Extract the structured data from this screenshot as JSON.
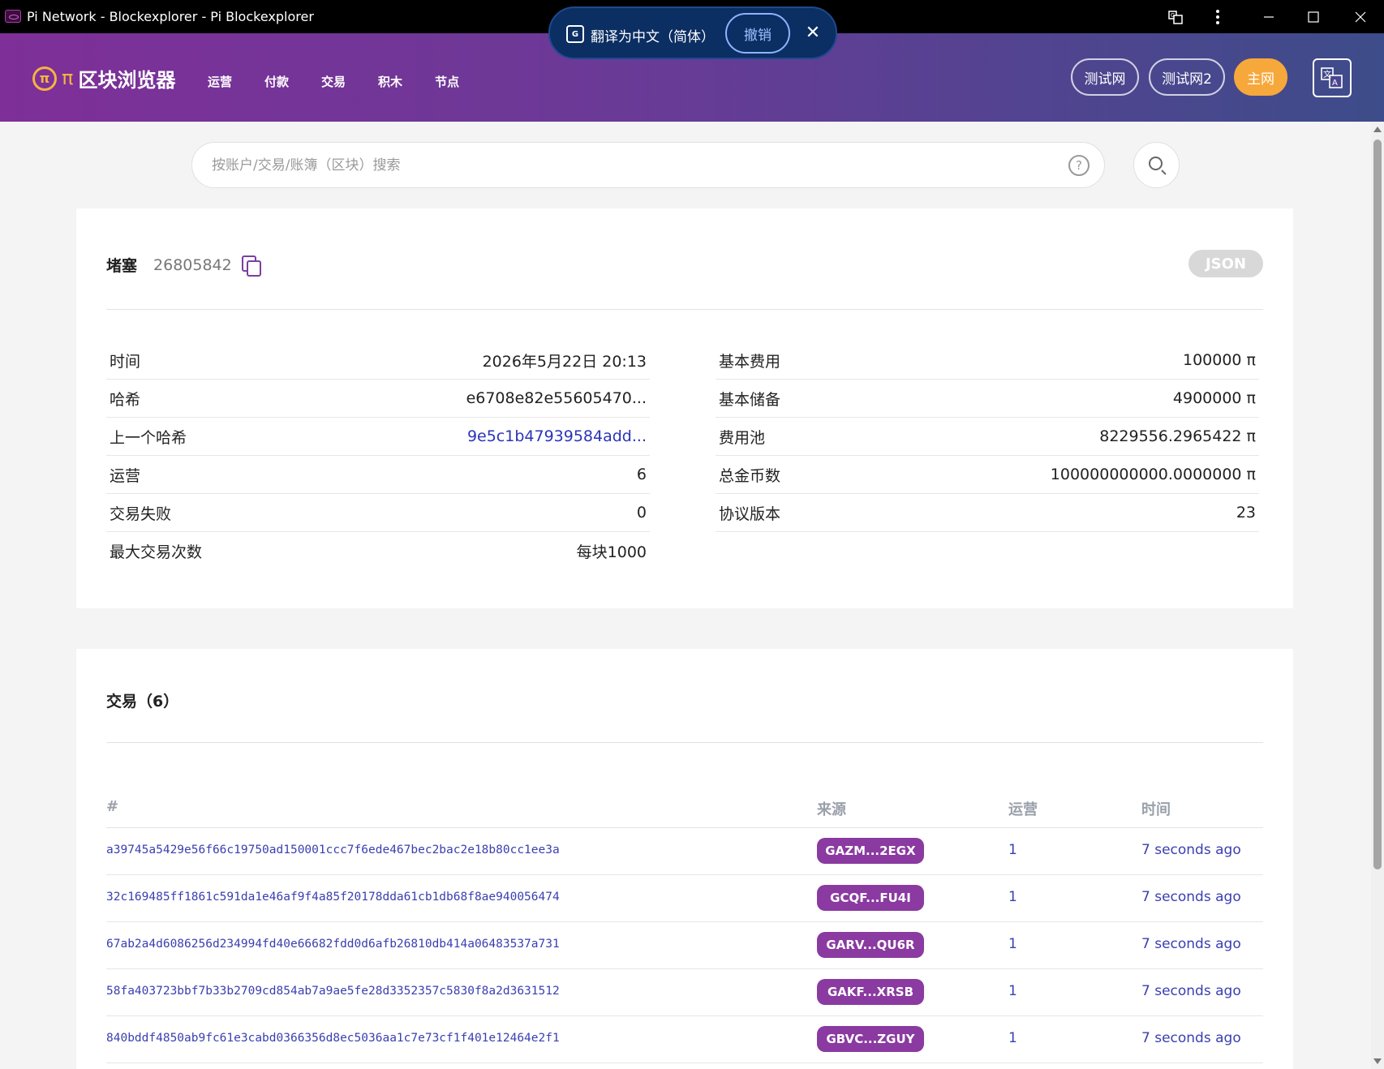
{
  "window": {
    "title": "Pi Network - Blockexplorer - Pi Blockexplorer"
  },
  "translate_bar": {
    "text": "翻译为中文（简体）",
    "undo_label": "撤销",
    "close_label": "✕"
  },
  "header": {
    "logo_text": "区块浏览器",
    "pi_symbol": "π",
    "nav": [
      "运营",
      "付款",
      "交易",
      "积木",
      "节点"
    ],
    "networks": [
      "测试网",
      "测试网2",
      "主网"
    ],
    "active_network": "主网"
  },
  "search": {
    "placeholder": "按账户/交易/账簿（区块）搜索",
    "help": "?"
  },
  "block": {
    "label": "堵塞",
    "number": "26805842",
    "json_label": "JSON",
    "left": [
      {
        "key": "时间",
        "value": "2026年5月22日 20:13"
      },
      {
        "key": "哈希",
        "value": "e6708e82e55605470..."
      },
      {
        "key": "上一个哈希",
        "value": "9e5c1b47939584add..."
      },
      {
        "key": "运营",
        "value": "6"
      },
      {
        "key": "交易失败",
        "value": "0"
      },
      {
        "key": "最大交易次数",
        "value": "每块1000"
      }
    ],
    "right": [
      {
        "key": "基本费用",
        "value": "100000 π"
      },
      {
        "key": "基本储备",
        "value": "4900000 π"
      },
      {
        "key": "费用池",
        "value": "8229556.2965422 π"
      },
      {
        "key": "总金币数",
        "value": "100000000000.0000000 π"
      },
      {
        "key": "协议版本",
        "value": "23"
      }
    ]
  },
  "transactions": {
    "title": "交易（6）",
    "columns": [
      "#",
      "来源",
      "运营",
      "时间"
    ],
    "rows": [
      {
        "hash": "a39745a5429e56f66c19750ad150001ccc7f6ede467bec2bac2e18b80cc1ee3a",
        "source": "GAZM...2EGX",
        "ops": "1",
        "time": "7 seconds ago"
      },
      {
        "hash": "32c169485ff1861c591da1e46af9f4a85f20178dda61cb1db68f8ae940056474",
        "source": "GCQF...FU4I",
        "ops": "1",
        "time": "7 seconds ago"
      },
      {
        "hash": "67ab2a4d6086256d234994fd40e66682fdd0d6afb26810db414a06483537a731",
        "source": "GARV...QU6R",
        "ops": "1",
        "time": "7 seconds ago"
      },
      {
        "hash": "58fa403723bbf7b33b2709cd854ab7a9ae5fe28d3352357c5830f8a2d3631512",
        "source": "GAKF...XRSB",
        "ops": "1",
        "time": "7 seconds ago"
      },
      {
        "hash": "840bddf4850ab9fc61e3cabd0366356d8ec5036aa1c7e73cf1f401e12464e2f1",
        "source": "GBVC...ZGUY",
        "ops": "1",
        "time": "7 seconds ago"
      }
    ]
  },
  "colors": {
    "header_start": "#7e2f98",
    "header_end": "#3d4c8a",
    "accent": "#f7a83b",
    "link": "#3a3fb0",
    "source_badge": "#8a3aa0"
  }
}
